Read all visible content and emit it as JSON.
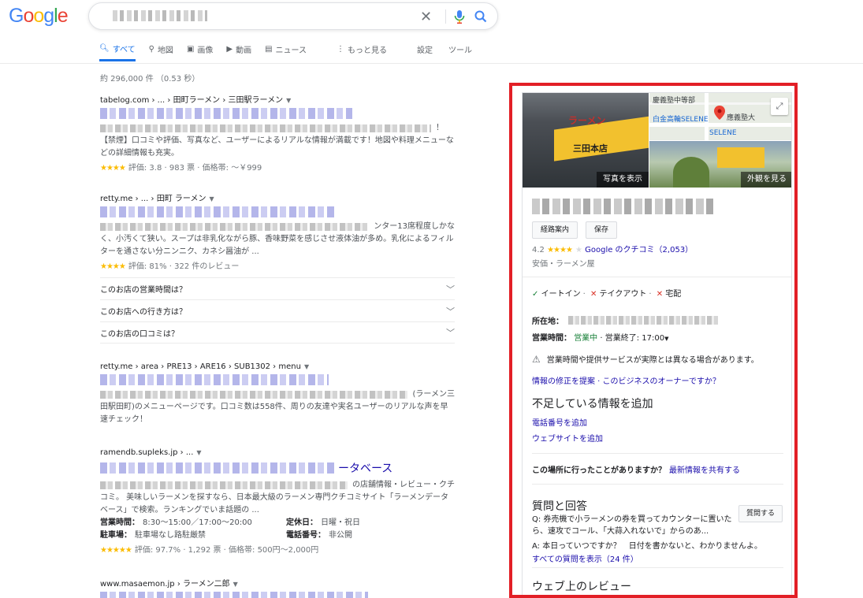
{
  "logo": {
    "letters": [
      "G",
      "o",
      "o",
      "g",
      "l",
      "e"
    ],
    "colors": [
      "#4285f4",
      "#ea4335",
      "#fbbc05",
      "#4285f4",
      "#34a853",
      "#ea4335"
    ]
  },
  "tabs": [
    {
      "label": "すべて",
      "icon": "search-icon",
      "active": true
    },
    {
      "label": "地図",
      "icon": "map-pin-icon"
    },
    {
      "label": "画像",
      "icon": "image-icon"
    },
    {
      "label": "動画",
      "icon": "video-icon"
    },
    {
      "label": "ニュース",
      "icon": "news-icon"
    },
    {
      "label": "もっと見る",
      "icon": "more-icon"
    },
    {
      "label": "設定"
    },
    {
      "label": "ツール"
    }
  ],
  "result_stats": "約 296,000 件 （0.53 秒）",
  "results": [
    {
      "cite": "tabelog.com › ... › 田町ラーメン › 三田駅ラーメン",
      "snippet": "【禁煙】口コミや評価、写真など、ユーザーによるリアルな情報が満載です！地図や料理メニューなどの詳細情報も充実。",
      "snippet_tail": "！",
      "stars": "★★★★",
      "rating": "評価: 3.8 · 983 票 · 価格帯: ～￥999"
    },
    {
      "cite": "retty.me › ... › 田町 ラーメン",
      "snippet_tail": "ンター13席程度しかな",
      "snippet": "く、小汚くて狭い。スープは非乳化ながら豚、香味野菜を感じさせ液体油が多め。乳化によるフィルターを通さない分ニンニク、カネシ醤油が ...",
      "stars": "★★★★",
      "rating": "評価: 81% · 322 件のレビュー"
    },
    {
      "cite": "retty.me › area › PRE13 › ARE16 › SUB1302 › menu",
      "snippet_tail": "(ラーメン三",
      "snippet": "田駅田町)のメニューページです。口コミ数は558件、周りの友達や実名ユーザーのリアルな声を早速チェック！"
    },
    {
      "cite": "ramendb.supleks.jp › ...",
      "title_tail": "ータベース",
      "snippet_tail": "の店舗情報・レビュー・クチ",
      "snippet": "コミ。 美味しいラーメンを探すなら、日本最大級のラーメン専門クチコミサイト「ラーメンデータベース」で検索。ランキングでいま話題の ...",
      "info": [
        {
          "label": "営業時間：",
          "value": "8:30～15:00／17:00～20:00"
        },
        {
          "label": "定休日：",
          "value": "日曜・祝日"
        },
        {
          "label": "駐車場：",
          "value": "駐車場なし路駐厳禁"
        },
        {
          "label": "電話番号：",
          "value": "非公開"
        }
      ],
      "stars": "★★★★★",
      "rating": "評価: 97.7% · 1,292 票 · 価格帯: 500円～2,000円"
    },
    {
      "cite": "www.masaemon.jp › ラーメン二郎"
    }
  ],
  "faq": [
    "このお店の営業時間は？",
    "このお店への行き方は？",
    "このお店の口コミは？"
  ],
  "kp": {
    "photos_label": "写真を表示",
    "exterior_label": "外観を見る",
    "map_labels": {
      "top": "慶義塾中等部",
      "mid": "白金高輪SELENE",
      "sub": "SELENE",
      "univ": "應義塾大"
    },
    "btn_directions": "経路案内",
    "btn_save": "保存",
    "rating_value": "4.2",
    "rating_stars": "★★★★",
    "reviews_link": "Google のクチコミ（2,053）",
    "category": "安価・ラーメン屋",
    "services": {
      "dine_in": "イートイン",
      "takeout": "テイクアウト",
      "delivery": "宅配"
    },
    "address_label": "所在地：",
    "hours_label": "営業時間：",
    "hours_status": "営業中",
    "hours_close": "· 営業終了: 17:00",
    "warning": "営業時間や提供サービスが実際とは異なる場合があります。",
    "edit_link": "情報の修正を提案 · このビジネスのオーナーですか？",
    "add_info_heading": "不足している情報を追加",
    "add_phone": "電話番号を追加",
    "add_website": "ウェブサイトを追加",
    "visited_q": "この場所に行ったことがありますか？",
    "visited_link": "最新情報を共有する",
    "qa_heading": "質問と回答",
    "ask_button": "質問する",
    "qa_question": "Q: 券売機で小ラーメンの券を買ってカウンターに置いたら、速攻でコール、「大蒜入れないで」からのあ...",
    "qa_answer": "A: 本日っていつですか？　日付を書かないと、わかりませんよ。",
    "all_questions": "すべての質問を表示（24 件）",
    "web_reviews": "ウェブ上のレビュー"
  }
}
